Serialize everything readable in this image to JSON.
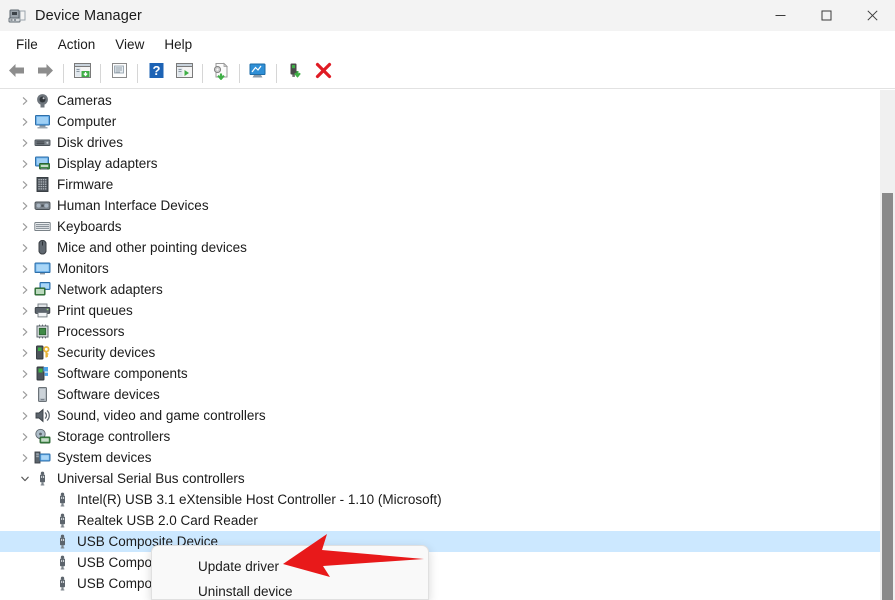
{
  "window": {
    "title": "Device Manager",
    "icon": "device-manager-icon",
    "controls": {
      "minimize": "—",
      "maximize": "☐",
      "close": "✕"
    }
  },
  "menubar": {
    "items": [
      {
        "label": "File",
        "name": "menu-file"
      },
      {
        "label": "Action",
        "name": "menu-action"
      },
      {
        "label": "View",
        "name": "menu-view"
      },
      {
        "label": "Help",
        "name": "menu-help"
      }
    ]
  },
  "toolbar": {
    "buttons": [
      {
        "name": "back-button",
        "icon": "back-arrow-icon",
        "tooltip": "Back"
      },
      {
        "name": "forward-button",
        "icon": "forward-arrow-icon",
        "tooltip": "Forward"
      },
      {
        "name": "show-hide-console-tree-button",
        "icon": "console-tree-icon",
        "tooltip": "Show/Hide Console Tree"
      },
      {
        "name": "properties-button",
        "icon": "properties-icon",
        "tooltip": "Properties"
      },
      {
        "name": "help-button",
        "icon": "help-question-icon",
        "tooltip": "Help"
      },
      {
        "name": "view-button",
        "icon": "view-panel-icon",
        "tooltip": "View"
      },
      {
        "name": "update-driver-button",
        "icon": "update-driver-icon",
        "tooltip": "Update driver"
      },
      {
        "name": "scan-hardware-changes-button",
        "icon": "scan-monitor-icon",
        "tooltip": "Scan for hardware changes"
      },
      {
        "name": "enable-device-button",
        "icon": "enable-device-icon",
        "tooltip": "Enable device"
      },
      {
        "name": "uninstall-device-button",
        "icon": "red-x-icon",
        "tooltip": "Uninstall device"
      }
    ]
  },
  "tree": {
    "items": [
      {
        "label": "Cameras",
        "icon": "camera-icon",
        "level": 1,
        "expanded": false,
        "selected": false
      },
      {
        "label": "Computer",
        "icon": "computer-monitor-icon",
        "level": 1,
        "expanded": false,
        "selected": false
      },
      {
        "label": "Disk drives",
        "icon": "disk-drive-icon",
        "level": 1,
        "expanded": false,
        "selected": false
      },
      {
        "label": "Display adapters",
        "icon": "display-adapter-icon",
        "level": 1,
        "expanded": false,
        "selected": false
      },
      {
        "label": "Firmware",
        "icon": "firmware-chip-icon",
        "level": 1,
        "expanded": false,
        "selected": false
      },
      {
        "label": "Human Interface Devices",
        "icon": "hid-icon",
        "level": 1,
        "expanded": false,
        "selected": false
      },
      {
        "label": "Keyboards",
        "icon": "keyboard-icon",
        "level": 1,
        "expanded": false,
        "selected": false
      },
      {
        "label": "Mice and other pointing devices",
        "icon": "mouse-icon",
        "level": 1,
        "expanded": false,
        "selected": false
      },
      {
        "label": "Monitors",
        "icon": "monitor-icon",
        "level": 1,
        "expanded": false,
        "selected": false
      },
      {
        "label": "Network adapters",
        "icon": "network-adapter-icon",
        "level": 1,
        "expanded": false,
        "selected": false
      },
      {
        "label": "Print queues",
        "icon": "printer-icon",
        "level": 1,
        "expanded": false,
        "selected": false
      },
      {
        "label": "Processors",
        "icon": "processor-icon",
        "level": 1,
        "expanded": false,
        "selected": false
      },
      {
        "label": "Security devices",
        "icon": "security-device-icon",
        "level": 1,
        "expanded": false,
        "selected": false
      },
      {
        "label": "Software components",
        "icon": "software-component-icon",
        "level": 1,
        "expanded": false,
        "selected": false
      },
      {
        "label": "Software devices",
        "icon": "software-device-icon",
        "level": 1,
        "expanded": false,
        "selected": false
      },
      {
        "label": "Sound, video and game controllers",
        "icon": "speaker-icon",
        "level": 1,
        "expanded": false,
        "selected": false
      },
      {
        "label": "Storage controllers",
        "icon": "storage-controller-icon",
        "level": 1,
        "expanded": false,
        "selected": false
      },
      {
        "label": "System devices",
        "icon": "system-device-icon",
        "level": 1,
        "expanded": false,
        "selected": false
      },
      {
        "label": "Universal Serial Bus controllers",
        "icon": "usb-icon",
        "level": 1,
        "expanded": true,
        "selected": false
      },
      {
        "label": "Intel(R) USB 3.1 eXtensible Host Controller - 1.10 (Microsoft)",
        "icon": "usb-icon",
        "level": 2,
        "expanded": null,
        "selected": false
      },
      {
        "label": "Realtek USB 2.0 Card Reader",
        "icon": "usb-icon",
        "level": 2,
        "expanded": null,
        "selected": false
      },
      {
        "label": "USB Composite Device",
        "icon": "usb-icon",
        "level": 2,
        "expanded": null,
        "selected": true
      },
      {
        "label": "USB Composite Device",
        "icon": "usb-icon",
        "level": 2,
        "expanded": null,
        "selected": false
      },
      {
        "label": "USB Composite Device",
        "icon": "usb-icon",
        "level": 2,
        "expanded": null,
        "selected": false
      }
    ]
  },
  "context_menu": {
    "items": [
      {
        "label": "Update driver",
        "name": "context-update-driver"
      },
      {
        "label": "Uninstall device",
        "name": "context-uninstall-device"
      }
    ]
  },
  "annotation": {
    "arrow": "red-left-arrow",
    "color": "#e8191a",
    "points_to": "Update driver"
  },
  "colors": {
    "titlebar_bg": "#f3f3f3",
    "selection_blue": "#cce8ff",
    "accent_red": "#e8191a",
    "scrollbar_thumb": "#8a8a8a"
  }
}
